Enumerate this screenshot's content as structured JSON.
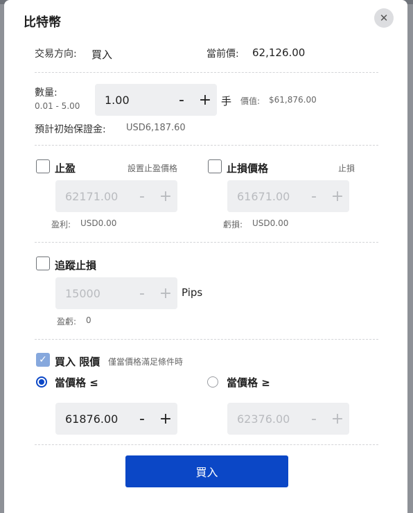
{
  "dialog": {
    "title": "比特幣"
  },
  "direction": {
    "label": "交易方向:",
    "value": "買入"
  },
  "current_price": {
    "label": "當前價:",
    "value": "62,126.00"
  },
  "quantity": {
    "label": "數量:",
    "range": "0.01 - 5.00",
    "value": "1.00",
    "unit": "手",
    "worth_label": "價值:",
    "worth_value": "$61,876.00"
  },
  "margin": {
    "label": "預計初始保證金:",
    "value": "USD6,187.60"
  },
  "steppers": {
    "minus": "-",
    "plus": "+"
  },
  "take_profit": {
    "label": "止盈",
    "hint": "設置止盈價格",
    "value": "62171.00",
    "result_label": "盈利:",
    "result_value": "USD0.00"
  },
  "stop_loss": {
    "label": "止損價格",
    "hint": "止損",
    "value": "61671.00",
    "result_label": "虧損:",
    "result_value": "USD0.00"
  },
  "trailing_stop": {
    "label": "追蹤止損",
    "value": "15000",
    "unit": "Pips",
    "result_label": "盈虧:",
    "result_value": "0"
  },
  "limit_order": {
    "label": "買入 限價",
    "hint": "僅當價格滿足條件時",
    "checked": true,
    "option_le": {
      "label": "當價格 ≤",
      "value": "61876.00",
      "selected": true
    },
    "option_ge": {
      "label": "當價格 ≥",
      "value": "62376.00",
      "selected": false
    }
  },
  "submit": {
    "label": "買入",
    "color": "#0b47c6"
  }
}
